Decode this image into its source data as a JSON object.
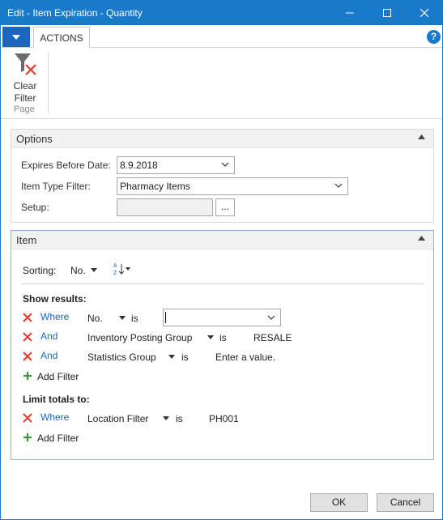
{
  "window": {
    "title": "Edit - Item Expiration - Quantity"
  },
  "tabs": {
    "actions_label": "ACTIONS",
    "help_label": "?"
  },
  "ribbon": {
    "clear_filter_line1": "Clear",
    "clear_filter_line2": "Filter",
    "group_label": "Page"
  },
  "options": {
    "header": "Options",
    "expires_label": "Expires Before Date:",
    "expires_value": "8.9.2018",
    "item_type_label": "Item Type Filter:",
    "item_type_value": "Pharmacy Items",
    "setup_label": "Setup:",
    "setup_value": "",
    "setup_button": "..."
  },
  "item": {
    "header": "Item",
    "sorting_label": "Sorting:",
    "sorting_value": "No.",
    "show_results_label": "Show results:",
    "filters": [
      {
        "connector": "Where",
        "field": "No.",
        "op": "is",
        "value": ""
      },
      {
        "connector": "And",
        "field": "Inventory Posting Group",
        "op": "is",
        "value": "RESALE"
      },
      {
        "connector": "And",
        "field": "Statistics Group",
        "op": "is",
        "value": "Enter a value."
      }
    ],
    "add_filter_label": "Add Filter",
    "limit_totals_label": "Limit totals to:",
    "totals_filters": [
      {
        "connector": "Where",
        "field": "Location Filter",
        "op": "is",
        "value": "PH001"
      }
    ],
    "add_filter_label_2": "Add Filter"
  },
  "footer": {
    "ok_label": "OK",
    "cancel_label": "Cancel"
  },
  "colors": {
    "accent": "#1979ca",
    "link": "#1c66bb",
    "delete_red": "#e03c31",
    "add_green": "#3a9a3a"
  }
}
